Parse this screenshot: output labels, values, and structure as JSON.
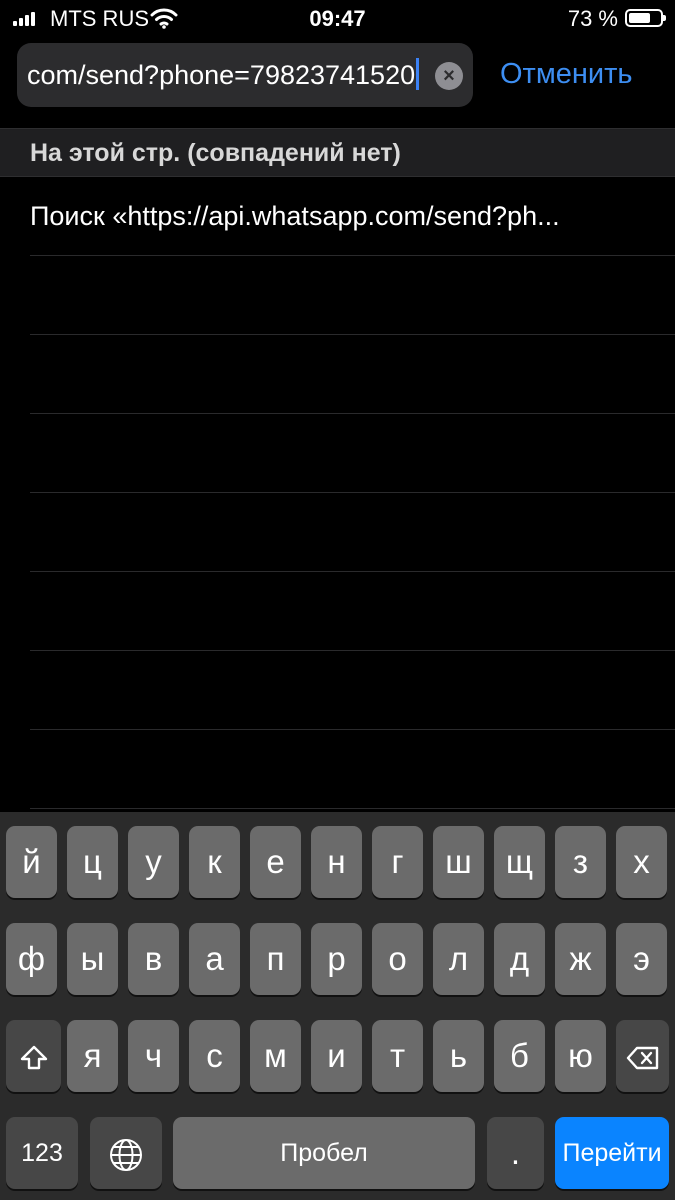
{
  "status_bar": {
    "carrier": "MTS RUS",
    "time": "09:47",
    "battery_percent": "73 %",
    "battery_level": 0.73
  },
  "address_bar": {
    "value": "com/send?phone=79823741520",
    "cancel_label": "Отменить"
  },
  "section_header": "На этой стр. (совпадений нет)",
  "results": {
    "suggestion": "Поиск «https://api.whatsapp.com/send?ph..."
  },
  "keyboard": {
    "row1": [
      "й",
      "ц",
      "у",
      "к",
      "е",
      "н",
      "г",
      "ш",
      "щ",
      "з",
      "х"
    ],
    "row2": [
      "ф",
      "ы",
      "в",
      "а",
      "п",
      "р",
      "о",
      "л",
      "д",
      "ж",
      "э"
    ],
    "row3": [
      "я",
      "ч",
      "с",
      "м",
      "и",
      "т",
      "ь",
      "б",
      "ю"
    ],
    "numbers_label": "123",
    "space_label": "Пробел",
    "dot_label": ".",
    "go_label": "Перейти"
  },
  "colors": {
    "accent": "#3d8ef2",
    "go_button": "#0a84ff"
  }
}
